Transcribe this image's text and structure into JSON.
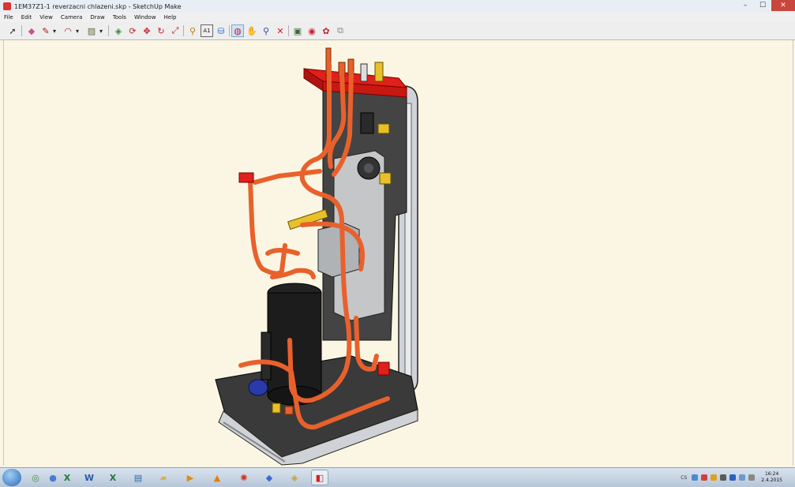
{
  "window": {
    "title": "1EM37Z1-1 reverzacni chlazeni.skp - SketchUp Make",
    "close_glyph": "✕",
    "maximize_glyph": "☐",
    "minimize_glyph": "–"
  },
  "menu": [
    "File",
    "Edit",
    "View",
    "Camera",
    "Draw",
    "Tools",
    "Window",
    "Help"
  ],
  "toolbar": [
    {
      "name": "select-tool",
      "glyph": "➚"
    },
    {
      "name": "eraser-tool",
      "glyph": "◆"
    },
    {
      "name": "pencil-tool",
      "glyph": "✎"
    },
    {
      "name": "line-dropdown",
      "glyph": "▾"
    },
    {
      "name": "arc-tool",
      "glyph": "◠"
    },
    {
      "name": "arc-dropdown",
      "glyph": "▾"
    },
    {
      "name": "shapes-tool",
      "glyph": "▨"
    },
    {
      "name": "shapes-dropdown",
      "glyph": "▾"
    },
    {
      "name": "push-pull-tool",
      "glyph": "◈"
    },
    {
      "name": "follow-me-tool",
      "glyph": "⟳"
    },
    {
      "name": "move-tool",
      "glyph": "✥"
    },
    {
      "name": "rotate-tool",
      "glyph": "↻"
    },
    {
      "name": "scale-tool",
      "glyph": "⤢"
    },
    {
      "name": "tape-measure-tool",
      "glyph": "⚲"
    },
    {
      "name": "text-tool",
      "glyph": "A1"
    },
    {
      "name": "paint-bucket-tool",
      "glyph": "⛁"
    },
    {
      "name": "orbit-tool",
      "glyph": "◍"
    },
    {
      "name": "pan-tool",
      "glyph": "✋"
    },
    {
      "name": "zoom-tool",
      "glyph": "⚲"
    },
    {
      "name": "zoom-extents-tool",
      "glyph": "✕"
    },
    {
      "name": "warehouse-tool",
      "glyph": "▣"
    },
    {
      "name": "components-tool",
      "glyph": "◉"
    },
    {
      "name": "share-tool",
      "glyph": "✿"
    },
    {
      "name": "extension-tool",
      "glyph": "⧉"
    }
  ],
  "taskbar": [
    {
      "name": "chrome-taskbar-icon",
      "glyph": "◎",
      "color": "#3a9a3a"
    },
    {
      "name": "app-taskbar-icon",
      "glyph": "●",
      "color": "#4a7bd0"
    },
    {
      "name": "excel-taskbar-icon",
      "glyph": "X",
      "color": "#1f7a3a"
    },
    {
      "name": "word-taskbar-icon",
      "glyph": "W",
      "color": "#2a5aa8"
    },
    {
      "name": "excel-taskbar-icon-2",
      "glyph": "X",
      "color": "#1f7a3a"
    },
    {
      "name": "remote-desktop-taskbar-icon",
      "glyph": "▤",
      "color": "#2a6aa8"
    },
    {
      "name": "folder-taskbar-icon",
      "glyph": "▰",
      "color": "#e0b040"
    },
    {
      "name": "media-player-taskbar-icon",
      "glyph": "▶",
      "color": "#e08a10"
    },
    {
      "name": "vlc-taskbar-icon",
      "glyph": "▲",
      "color": "#f07a00"
    },
    {
      "name": "app-red-taskbar-icon",
      "glyph": "✺",
      "color": "#d03020"
    },
    {
      "name": "app-blue-taskbar-icon",
      "glyph": "◆",
      "color": "#3a6ad0"
    },
    {
      "name": "app-gold-taskbar-icon",
      "glyph": "◈",
      "color": "#d0a020"
    },
    {
      "name": "sketchup-taskbar-icon",
      "glyph": "◧",
      "color": "#d02020"
    }
  ],
  "tray": {
    "lang": "CS",
    "time": "16:24",
    "date": "2.4.2015"
  },
  "colors": {
    "pipe": "#e8612c",
    "frame": "#cfd2d6",
    "plate": "#3a3a3a",
    "manifold": "#e0201a",
    "brass": "#e8c02a",
    "viewport_bg": "#fbf6e3"
  }
}
